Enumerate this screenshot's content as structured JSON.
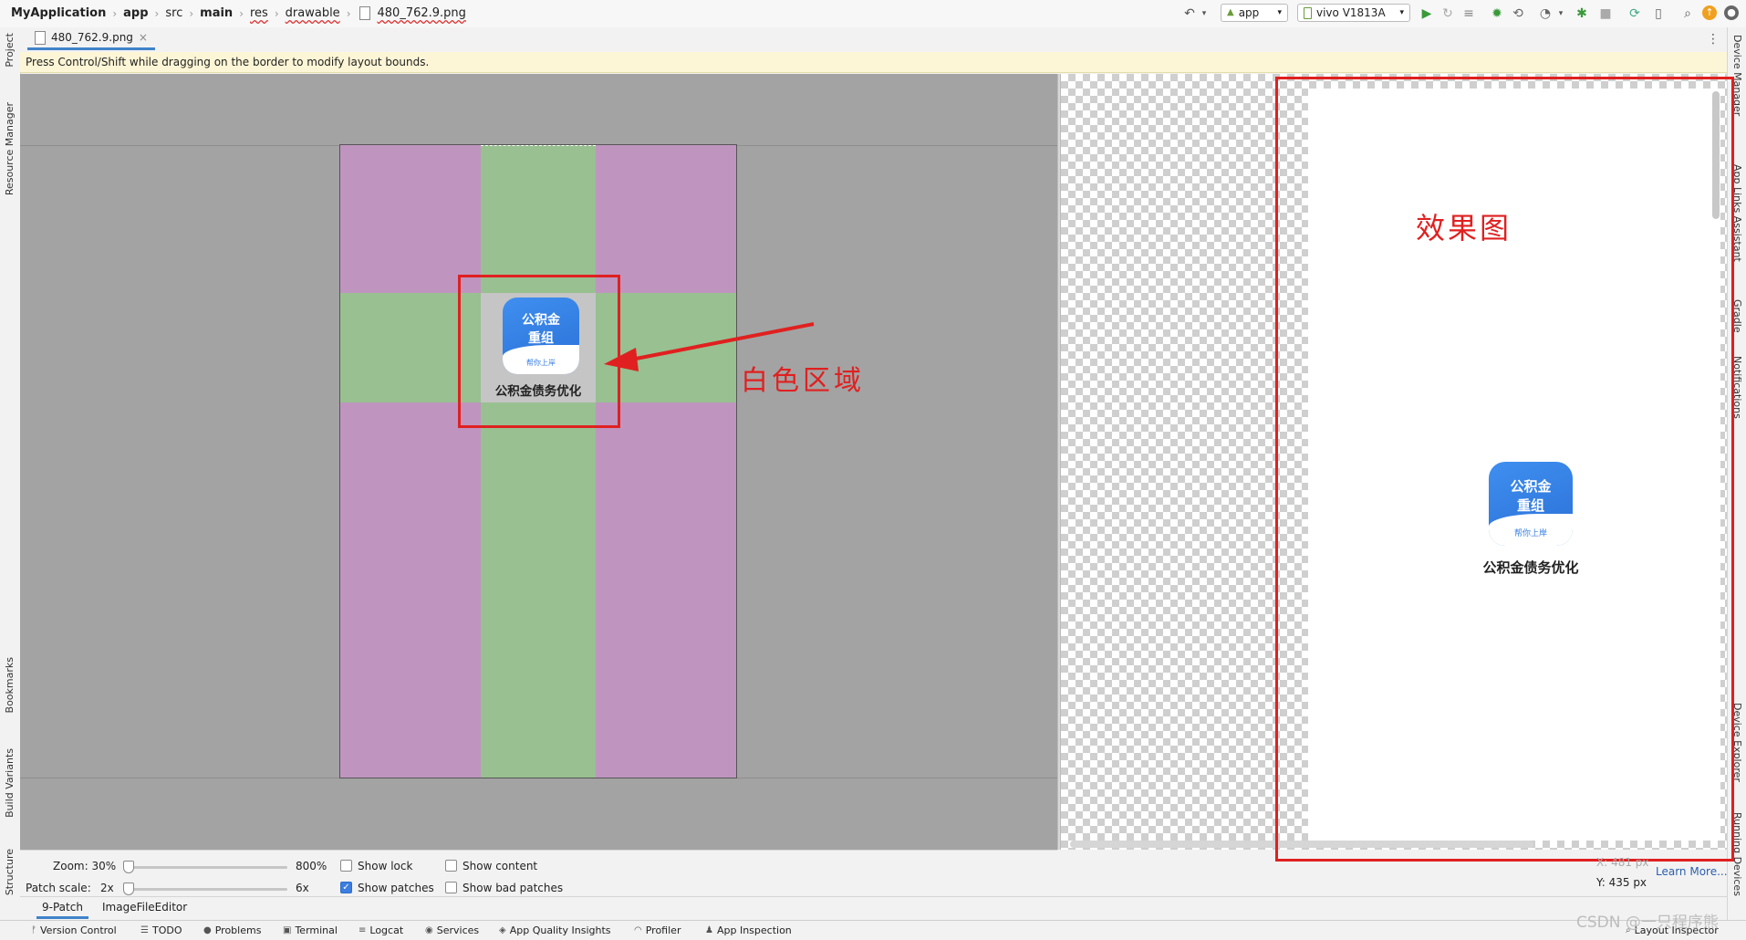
{
  "breadcrumb": {
    "items": [
      "MyApplication",
      "app",
      "src",
      "main",
      "res",
      "drawable",
      "480_762.9.png"
    ]
  },
  "toolbar": {
    "run_config": "app",
    "device": "vivo V1813A"
  },
  "left_tool_windows": [
    "Project",
    "Resource Manager",
    "Bookmarks",
    "Build Variants",
    "Structure"
  ],
  "right_tool_windows": [
    "Device Manager",
    "App Links Assistant",
    "Gradle",
    "Notifications",
    "Device Explorer",
    "Running Devices",
    "Layout Inspector"
  ],
  "editor_tab": {
    "label": "480_762.9.png"
  },
  "banner": {
    "text": "Press Control/Shift while dragging on the border to modify layout bounds."
  },
  "image": {
    "logo_line1": "公积金",
    "logo_line2": "重组",
    "logo_tagline": "帮你上岸",
    "caption": "公积金债务优化"
  },
  "annotations": {
    "white_area": "白色区域",
    "effect": "效果图",
    "color": "#e02020"
  },
  "controls": {
    "zoom_label": "Zoom: 30%",
    "zoom_max": "800%",
    "zoom_value": 0.0,
    "patch_scale_label": "Patch scale:",
    "patch_scale_min": "2x",
    "patch_scale_max": "6x",
    "patch_scale_value": 0.0,
    "show_lock": {
      "label": "Show lock",
      "checked": false
    },
    "show_patches": {
      "label": "Show patches",
      "checked": true
    },
    "show_content": {
      "label": "Show content",
      "checked": false
    },
    "show_bad_patches": {
      "label": "Show bad patches",
      "checked": false
    }
  },
  "preview_info": {
    "x": "X: 481 px",
    "y": "Y: 435 px",
    "learn_more": "Learn More..."
  },
  "editor_subtabs": [
    "9-Patch",
    "ImageFileEditor"
  ],
  "bottom_tools": [
    "Version Control",
    "TODO",
    "Problems",
    "Terminal",
    "Logcat",
    "Services",
    "App Quality Insights",
    "Profiler",
    "App Inspection"
  ],
  "watermark": "CSDN @一只程序熊",
  "colors": {
    "patch_stretch": "#98c090",
    "patch_fixed": "#bf95bf",
    "accent": "#4083c9",
    "logo_blue": "#2a6fd6"
  }
}
